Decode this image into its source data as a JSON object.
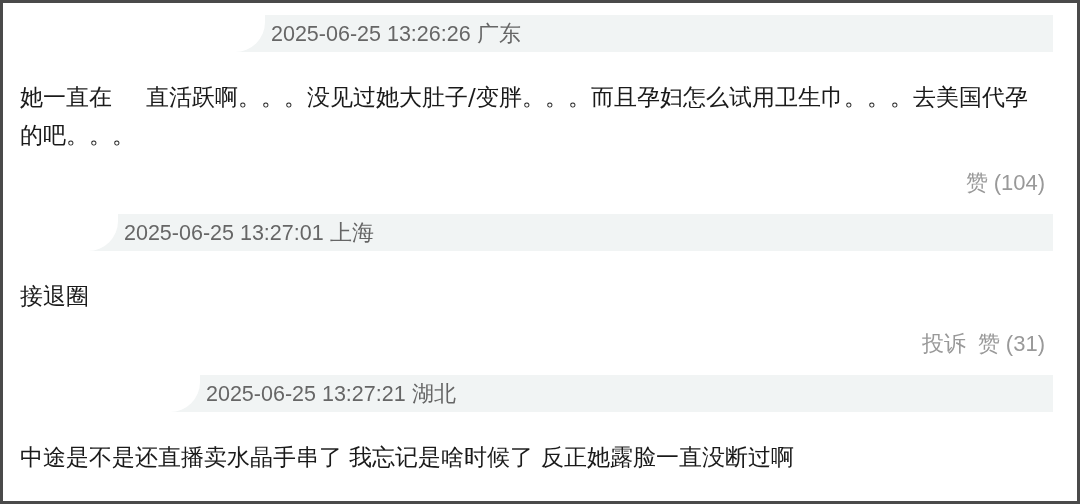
{
  "comments": [
    {
      "meta": "2025-06-25 13:26:26 广东",
      "text_segments": [
        "她一直在",
        "直活跃啊。。。没见过她大肚子/变胖。。。而且孕妇怎么试用卫生巾。。。去美国代孕的吧。。。"
      ],
      "actions": [
        "赞 (104)"
      ]
    },
    {
      "meta": "2025-06-25 13:27:01 上海",
      "text_segments": [
        "接退圈"
      ],
      "actions": [
        "投诉",
        "赞 (31)"
      ]
    },
    {
      "meta": "2025-06-25 13:27:21 湖北",
      "text_segments": [
        "中途是不是还直播卖水晶手串了 我忘记是啥时候了 反正她露脸一直没断过啊"
      ]
    }
  ]
}
